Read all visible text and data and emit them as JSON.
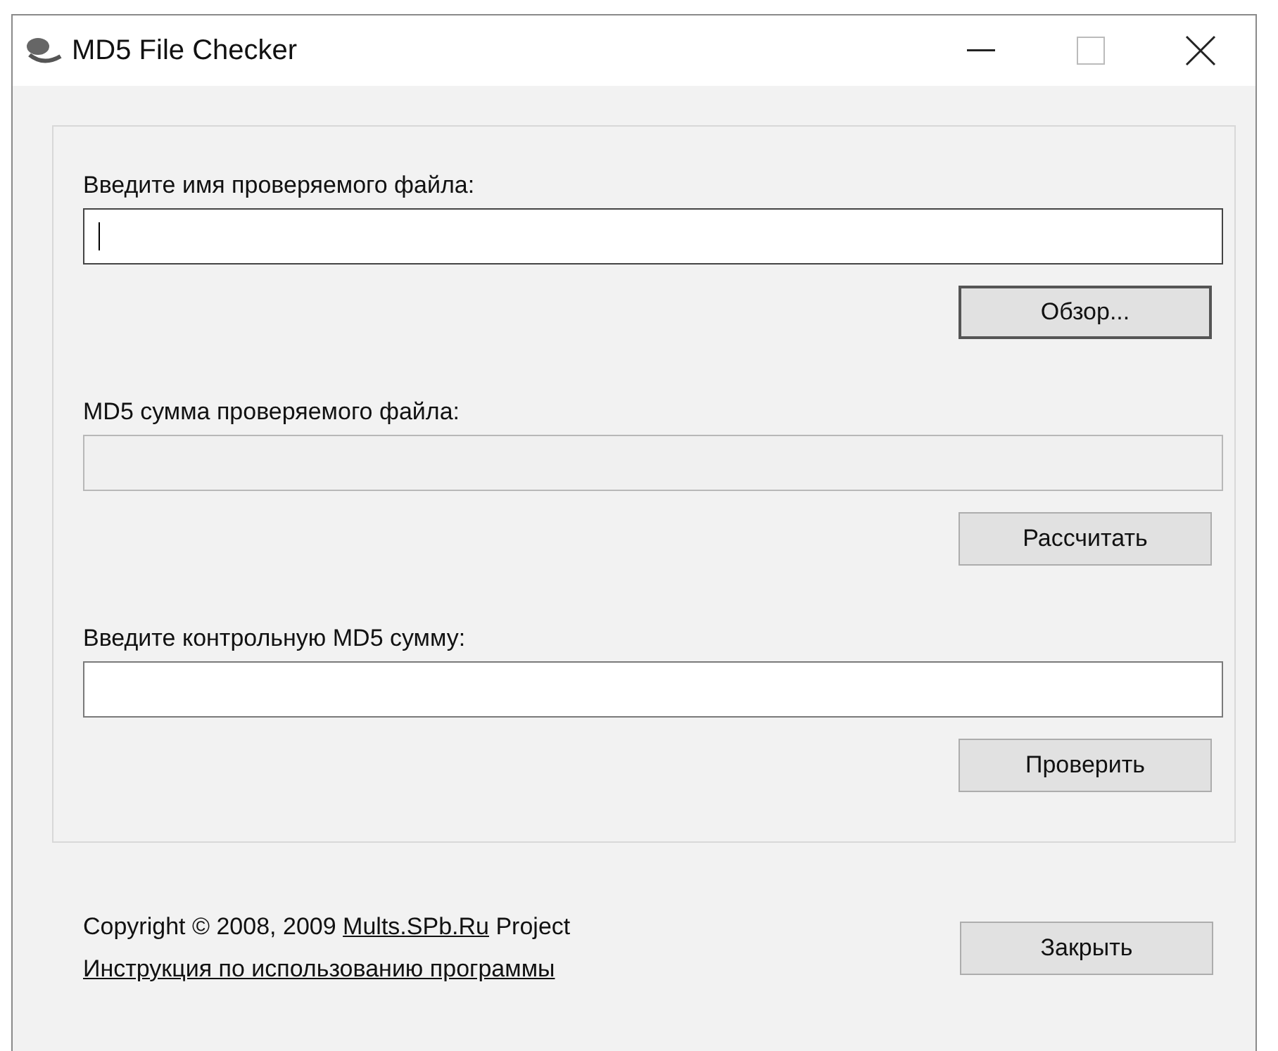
{
  "window": {
    "title": "MD5 File Checker"
  },
  "fields": [
    {
      "label": "Введите имя проверяемого файла:",
      "focused": true,
      "disabled": false,
      "button": {
        "label": "Обзор...",
        "default": true
      }
    },
    {
      "label": "MD5 сумма проверяемого файла:",
      "focused": false,
      "disabled": true,
      "button": {
        "label": "Рассчитать",
        "default": false
      }
    },
    {
      "label": "Введите контрольную MD5 сумму:",
      "focused": false,
      "disabled": false,
      "button": {
        "label": "Проверить",
        "default": false
      }
    }
  ],
  "footer": {
    "copyright_before": "Copyright © 2008, 2009",
    "site_link": "Mults.SPb.Ru",
    "copyright_after": "Project",
    "help_link": "Инструкция по использованию программы",
    "close_button": "Закрыть"
  }
}
